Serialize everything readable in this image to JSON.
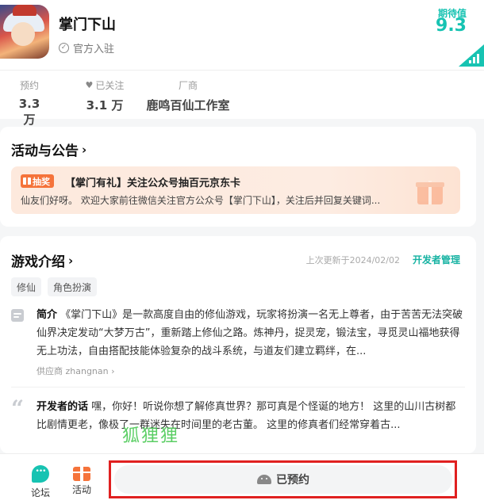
{
  "app": {
    "name": "掌门下山",
    "official_label": "官方入驻",
    "expect_label": "期待值",
    "expect_score": "9.3",
    "icon": "game-avatar-icon"
  },
  "stats": [
    {
      "label": "预约",
      "value": "3.3 万"
    },
    {
      "label": "已关注",
      "value": "3.1 万",
      "icon": "heart-icon"
    },
    {
      "label": "厂商",
      "value": "鹿鸣百仙工作室"
    }
  ],
  "activity": {
    "section_title": "活动与公告",
    "tag": "抽奖",
    "title": "【掌门有礼】关注公众号抽百元京东卡",
    "desc": "仙友们好呀。 欢迎大家前往微信关注官方公众号【掌门下山】，关注后并回复关键词..."
  },
  "intro": {
    "section_title": "游戏介绍",
    "updated": "上次更新于2024/02/02",
    "dev_manage": "开发者管理",
    "tags": [
      "修仙",
      "角色扮演"
    ],
    "summary_label": "简介",
    "summary_text": "《掌门下山》是一款高度自由的修仙游戏，玩家将扮演一名无上尊者，由于苦苦无法突破仙界决定发动“大梦万古”，重新踏上修仙之路。炼神丹，捉灵宠，锻法宝，寻觅灵山福地获得无上功法，自由搭配技能体验复杂的战斗系统，与道友们建立羁绊，在...",
    "supplier": "供应商 zhangnan",
    "dev_label": "开发者的话",
    "dev_text": "嘿，你好！听说你想了解修真世界？那可真是个怪诞的地方！ 这里的山川古树都比剧情更老，像极了一群迷失在时间里的老古董。 这里的修真者们经常穿着古...",
    "watermark": "狐狸狸"
  },
  "bottom": {
    "forum": "论坛",
    "activity": "活动",
    "reserve": "已预约"
  },
  "colors": {
    "accent": "#17c3b2",
    "orange": "#f5733a",
    "highlight_border": "#e02020"
  }
}
